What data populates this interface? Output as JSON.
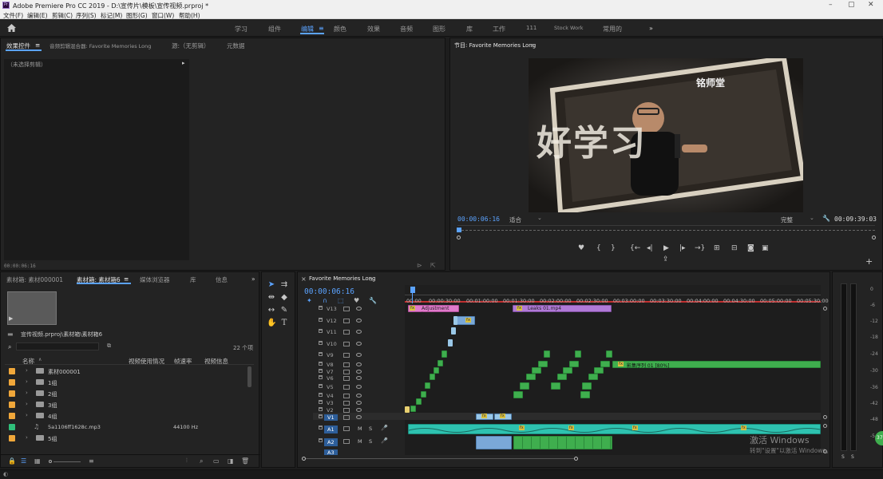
{
  "app": {
    "icon_label": "Pr",
    "title": "Adobe Premiere Pro CC 2019 - D:\\宣传片\\模板\\宣传视频.prproj *"
  },
  "menu": [
    "文件(F)",
    "编辑(E)",
    "剪辑(C)",
    "序列(S)",
    "标记(M)",
    "图形(G)",
    "窗口(W)",
    "帮助(H)"
  ],
  "workspaces": {
    "items": [
      "学习",
      "组件",
      "编辑",
      "颜色",
      "效果",
      "音频",
      "图形",
      "库",
      "工作",
      "111",
      "Stock Work",
      "常用的"
    ],
    "active": "编辑",
    "more": "»"
  },
  "effect_controls": {
    "tabs": [
      "效果控件",
      "音频剪辑混合器: Favorite Memories Long",
      "源:（无剪辑）",
      "元数据"
    ],
    "no_clip": "（未选择剪辑）",
    "timecode": "00:00:06:16"
  },
  "program": {
    "title": "节目: Favorite Memories Long",
    "timecode": "00:00:06:16",
    "fit": "适合",
    "quality": "完整",
    "duration": "00:09:39:03",
    "frame_text_big": "好学习",
    "frame_logo": "铭师堂"
  },
  "project": {
    "tabs": [
      "素材箱: 素材000001",
      "素材箱: 素材箱6",
      "媒体浏览器",
      "库",
      "信息"
    ],
    "more": "»",
    "path": "宣传视频.prproj\\素材箱\\素材箱6",
    "item_count": "22 个项",
    "columns": [
      "名称",
      "视频使用情况",
      "帧速率",
      "视频信息"
    ],
    "rows": [
      {
        "name": "素材000001",
        "type": "folder",
        "rate": ""
      },
      {
        "name": "1组",
        "type": "folder",
        "rate": ""
      },
      {
        "name": "2组",
        "type": "folder",
        "rate": ""
      },
      {
        "name": "3组",
        "type": "folder",
        "rate": ""
      },
      {
        "name": "4组",
        "type": "folder",
        "rate": ""
      },
      {
        "name": "5a1106ff1628c.mp3",
        "type": "audio",
        "rate": "44100 Hz"
      },
      {
        "name": "5组",
        "type": "folder",
        "rate": ""
      }
    ]
  },
  "timeline": {
    "sequence": "Favorite Memories Long",
    "timecode": "00:00:06:16",
    "ruler": [
      "00:00",
      "00:00:30:00",
      "00:01:00:00",
      "00:01:30:00",
      "00:02:00:00",
      "00:02:30:00",
      "00:03:00:00",
      "00:03:30:00",
      "00:04:00:00",
      "00:04:30:00",
      "00:05:00:00",
      "00:05:30:00"
    ],
    "video_tracks": [
      "V13",
      "V12",
      "V11",
      "V10",
      "V9",
      "V8",
      "V7",
      "V6",
      "V5",
      "V4",
      "V3",
      "V2",
      "V1"
    ],
    "audio_tracks": [
      "A1",
      "A2",
      "A3"
    ],
    "audio_btns": [
      "M",
      "S"
    ],
    "clip_adjustment": "Adjustment Layer",
    "clip_leaks": "Leaks 01.mp4",
    "clip_green_label": "影集序列 01 [80%]",
    "fx": "fx"
  },
  "meters": {
    "labels": [
      "0",
      "-6",
      "-12",
      "-18",
      "-24",
      "-30",
      "-36",
      "-42",
      "-48",
      "-54"
    ],
    "solo": "S"
  },
  "watermark": {
    "line1": "激活 Windows",
    "line2": "转到\"设置\"以激活 Windows。"
  },
  "badge": "37"
}
